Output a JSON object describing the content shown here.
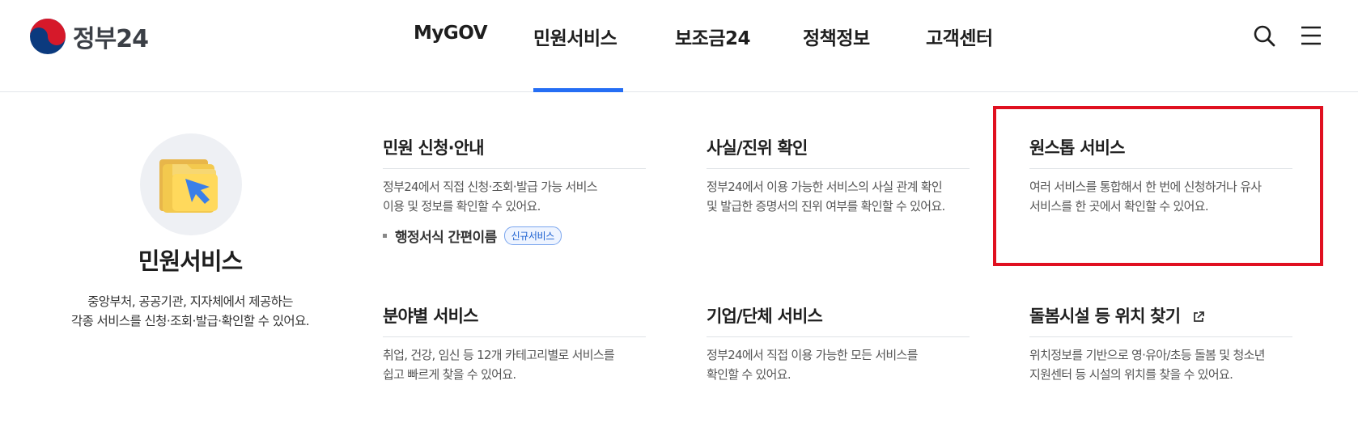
{
  "header": {
    "logo_text": "정부24",
    "nav": [
      {
        "label": "MyGOV"
      },
      {
        "label": "민원서비스"
      },
      {
        "label": "보조금24"
      },
      {
        "label": "정책정보"
      },
      {
        "label": "고객센터"
      }
    ],
    "active_nav": "민원서비스",
    "icons": [
      "search-icon",
      "menu-icon"
    ],
    "accent_color": "#256ef4"
  },
  "intro": {
    "icon": "folder-arrow-icon",
    "title": "민원서비스",
    "desc_line1": "중앙부처, 공공기관, 지자체에서 제공하는",
    "desc_line2": "각종 서비스를 신청·조회·발급·확인할 수 있어요."
  },
  "cards": [
    {
      "title": "민원 신청·안내",
      "desc_line1": "정부24에서 직접 신청·조회·발급 가능 서비스",
      "desc_line2": "이용 및 정보를 확인할 수 있어요.",
      "link_label": "행정서식 간편이름",
      "badge": "신규서비스"
    },
    {
      "title": "사실/진위 확인",
      "desc_line1": "정부24에서 이용 가능한 서비스의 사실 관계 확인",
      "desc_line2": "및 발급한 증명서의 진위 여부를 확인할 수 있어요."
    },
    {
      "title": "원스톱 서비스",
      "desc_line1": "여러 서비스를 통합해서 한 번에 신청하거나 유사",
      "desc_line2": "서비스를 한 곳에서 확인할 수 있어요."
    },
    {
      "title": "분야별 서비스",
      "desc_line1": "취업, 건강, 임신 등 12개 카테고리별로 서비스를",
      "desc_line2": "쉽고 빠르게 찾을 수 있어요."
    },
    {
      "title": "기업/단체 서비스",
      "desc_line1": "정부24에서 직접 이용 가능한 모든 서비스를",
      "desc_line2": "확인할 수 있어요."
    },
    {
      "title": "돌봄시설 등 위치 찾기",
      "icon": "external-link-icon",
      "desc_line1": "위치정보를 기반으로 영·유아/초등 돌봄 및 청소년",
      "desc_line2": "지원센터 등 시설의 위치를 찾을 수 있어요."
    }
  ],
  "highlight_color": "#e01020"
}
